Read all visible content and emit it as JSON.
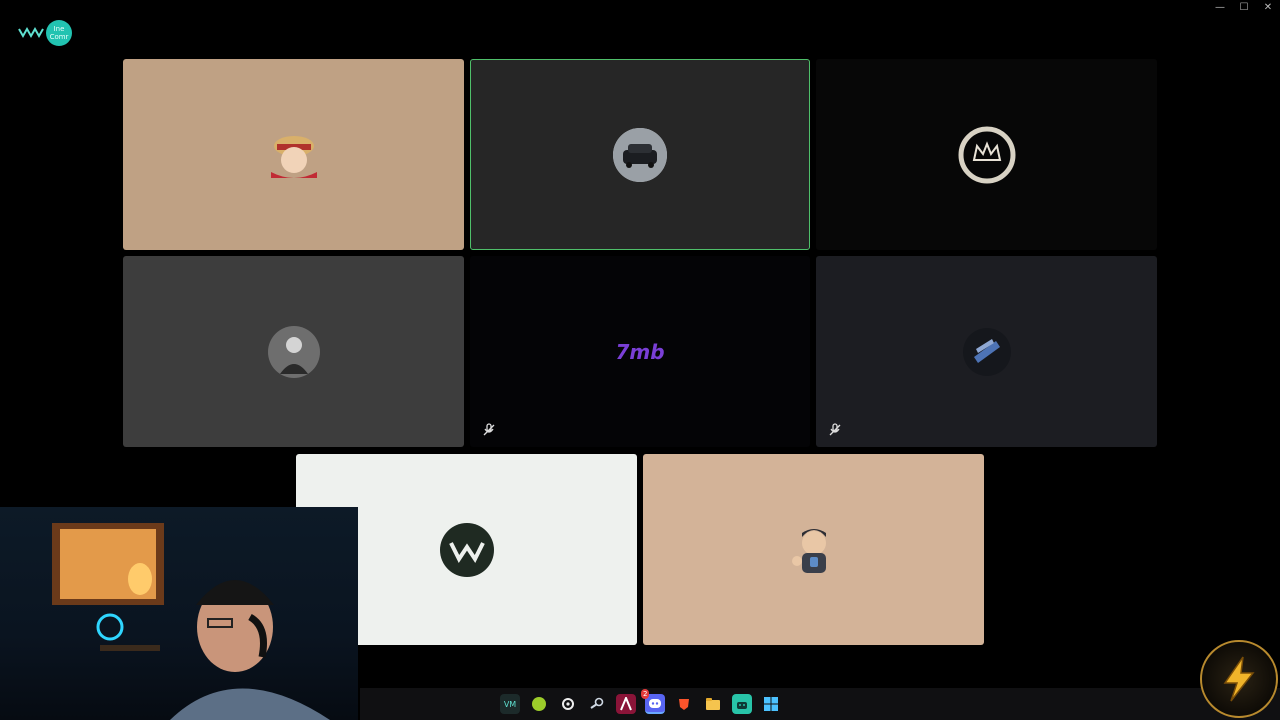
{
  "app": {
    "logo_badge_line1": "Ine",
    "logo_badge_line2": "Comr",
    "window_controls": {
      "minimize": "—",
      "maximize": "☐",
      "close": "✕"
    }
  },
  "tiles": [
    {
      "id": "user-1",
      "avatar_icon": "straw-hat-character-avatar-icon",
      "bg": "#bfa184",
      "muted": false,
      "speaking": false
    },
    {
      "id": "user-2",
      "avatar_icon": "car-avatar-icon",
      "bg": "#262626",
      "muted": false,
      "speaking": true
    },
    {
      "id": "user-3",
      "avatar_icon": "crown-ring-avatar-icon",
      "bg": "#070707",
      "muted": false,
      "speaking": false
    },
    {
      "id": "user-4",
      "avatar_icon": "man-portrait-avatar-icon",
      "bg": "#3d3d3d",
      "muted": false,
      "speaking": false
    },
    {
      "id": "user-5",
      "avatar_icon": "7mb-logo-avatar-icon",
      "avatar_text": "7mb",
      "bg": "#040406",
      "muted": true,
      "speaking": false
    },
    {
      "id": "user-6",
      "avatar_icon": "blue-emblem-avatar-icon",
      "bg": "#1c1d22",
      "muted": true,
      "speaking": false
    },
    {
      "id": "user-7",
      "avatar_icon": "w-logo-avatar-icon",
      "bg": "#eef1ee",
      "muted": false,
      "speaking": false
    },
    {
      "id": "user-8",
      "avatar_icon": "cartoon-thumbs-up-avatar-icon",
      "bg": "#d3b398",
      "muted": false,
      "speaking": false
    }
  ],
  "colors": {
    "speaking_border": "#4fbf6a",
    "accent": "#22c3b1"
  },
  "taskbar": {
    "icons": [
      "terminal-icon",
      "green-ball-icon",
      "steelseries-icon",
      "steam-icon",
      "affinity-icon",
      "discord-icon",
      "brave-icon",
      "file-explorer-icon",
      "android-icon",
      "windows-icon"
    ],
    "discord_badge": "2"
  },
  "overlay": {
    "bolt_icon": "lightning-bolt-icon"
  }
}
